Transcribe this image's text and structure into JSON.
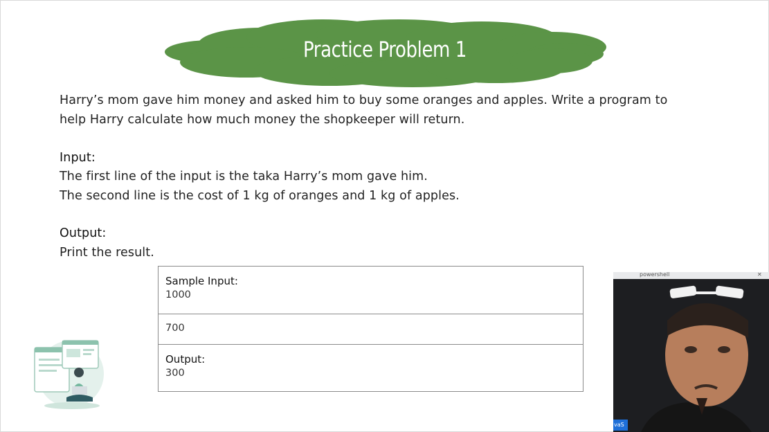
{
  "slide": {
    "title": "Practice Problem 1",
    "description_line1": "Harry’s mom gave him money and asked him to buy some oranges and apples. Write a program to",
    "description_line2": "help Harry calculate how much money the shopkeeper will return.",
    "input_label": "Input:",
    "input_line1": "The first line of the input is the taka Harry’s mom gave him.",
    "input_line2": "The second line is the cost of 1 kg of oranges and 1 kg of apples.",
    "output_label": "Output:",
    "output_line1": "Print the result."
  },
  "sample_table": {
    "rows": [
      {
        "label": "Sample Input:",
        "value": "1000"
      },
      {
        "label": "",
        "value": "700"
      },
      {
        "label": "Output:",
        "value": "300"
      }
    ]
  },
  "webcam": {
    "bar_label": "powershell",
    "tag_label": "vaS"
  },
  "colors": {
    "title_cloud": "#5b9447",
    "title_text": "#ffffff",
    "table_border": "#8a8a8a"
  }
}
